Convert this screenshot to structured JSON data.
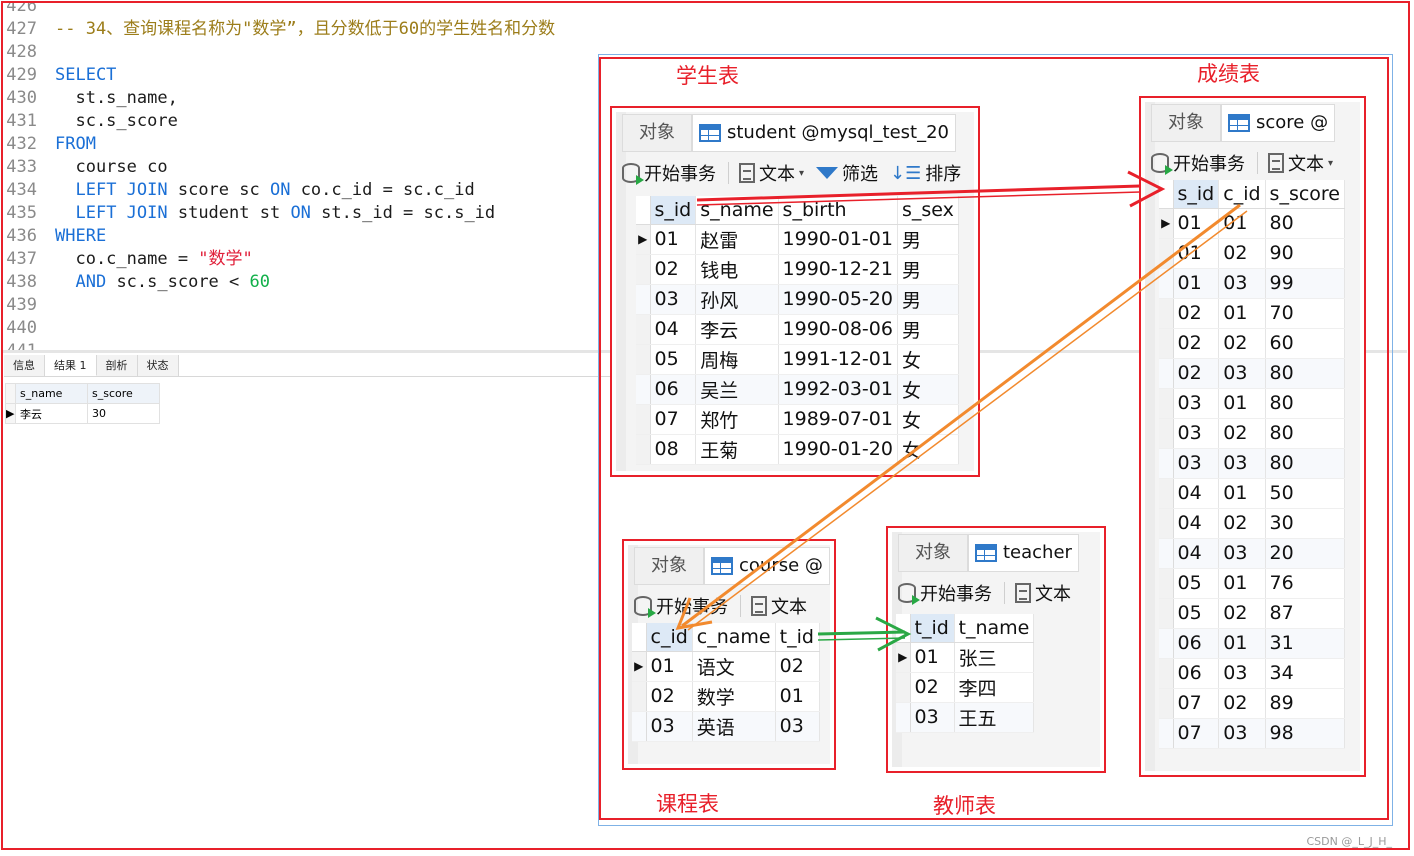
{
  "editor": {
    "lines": [
      {
        "n": "426",
        "parts": []
      },
      {
        "n": "427",
        "parts": [
          {
            "c": "cm",
            "t": "-- 34、查询课程名称为\"数学”，且分数低于60的学生姓名和分数"
          }
        ]
      },
      {
        "n": "428",
        "parts": []
      },
      {
        "n": "429",
        "parts": [
          {
            "c": "kw",
            "t": "SELECT"
          }
        ]
      },
      {
        "n": "430",
        "parts": [
          {
            "c": "tx",
            "t": "  st.s_name,"
          }
        ]
      },
      {
        "n": "431",
        "parts": [
          {
            "c": "tx",
            "t": "  sc.s_score"
          }
        ]
      },
      {
        "n": "432",
        "parts": [
          {
            "c": "kw",
            "t": "FROM"
          }
        ]
      },
      {
        "n": "433",
        "parts": [
          {
            "c": "tx",
            "t": "  course co"
          }
        ]
      },
      {
        "n": "434",
        "parts": [
          {
            "c": "tx",
            "t": "  "
          },
          {
            "c": "kw",
            "t": "LEFT JOIN"
          },
          {
            "c": "tx",
            "t": " score sc "
          },
          {
            "c": "kw",
            "t": "ON"
          },
          {
            "c": "tx",
            "t": " co.c_id = sc.c_id"
          }
        ]
      },
      {
        "n": "435",
        "parts": [
          {
            "c": "tx",
            "t": "  "
          },
          {
            "c": "kw",
            "t": "LEFT JOIN"
          },
          {
            "c": "tx",
            "t": " student st "
          },
          {
            "c": "kw",
            "t": "ON"
          },
          {
            "c": "tx",
            "t": " st.s_id = sc.s_id"
          }
        ]
      },
      {
        "n": "436",
        "parts": [
          {
            "c": "kw",
            "t": "WHERE"
          }
        ]
      },
      {
        "n": "437",
        "parts": [
          {
            "c": "tx",
            "t": "  co.c_name = "
          },
          {
            "c": "str",
            "t": "\"数学\""
          }
        ]
      },
      {
        "n": "438",
        "parts": [
          {
            "c": "tx",
            "t": "  "
          },
          {
            "c": "kw",
            "t": "AND"
          },
          {
            "c": "tx",
            "t": " sc.s_score < "
          },
          {
            "c": "num",
            "t": "60"
          }
        ]
      },
      {
        "n": "439",
        "parts": []
      },
      {
        "n": "440",
        "parts": []
      },
      {
        "n": "441",
        "parts": []
      }
    ]
  },
  "result_panel": {
    "tabs": [
      "信息",
      "结果 1",
      "剖析",
      "状态"
    ],
    "active_tab": 1,
    "columns": [
      "s_name",
      "s_score"
    ],
    "rows": [
      [
        "李云",
        "30"
      ]
    ]
  },
  "labels": {
    "student": "学生表",
    "score": "成绩表",
    "course": "课程表",
    "teacher": "教师表"
  },
  "common": {
    "objects_tab": "对象",
    "begin_tx": "开始事务",
    "text": "文本",
    "filter": "筛选",
    "sort": "排序"
  },
  "student": {
    "tab": "student @mysql_test_20",
    "columns": [
      "s_id",
      "s_name",
      "s_birth",
      "s_sex"
    ],
    "rows": [
      [
        "01",
        "赵雷",
        "1990-01-01",
        "男"
      ],
      [
        "02",
        "钱电",
        "1990-12-21",
        "男"
      ],
      [
        "03",
        "孙风",
        "1990-05-20",
        "男"
      ],
      [
        "04",
        "李云",
        "1990-08-06",
        "男"
      ],
      [
        "05",
        "周梅",
        "1991-12-01",
        "女"
      ],
      [
        "06",
        "吴兰",
        "1992-03-01",
        "女"
      ],
      [
        "07",
        "郑竹",
        "1989-07-01",
        "女"
      ],
      [
        "08",
        "王菊",
        "1990-01-20",
        "女"
      ]
    ]
  },
  "score": {
    "tab": "score @",
    "columns": [
      "s_id",
      "c_id",
      "s_score"
    ],
    "rows": [
      [
        "01",
        "01",
        "80"
      ],
      [
        "01",
        "02",
        "90"
      ],
      [
        "01",
        "03",
        "99"
      ],
      [
        "02",
        "01",
        "70"
      ],
      [
        "02",
        "02",
        "60"
      ],
      [
        "02",
        "03",
        "80"
      ],
      [
        "03",
        "01",
        "80"
      ],
      [
        "03",
        "02",
        "80"
      ],
      [
        "03",
        "03",
        "80"
      ],
      [
        "04",
        "01",
        "50"
      ],
      [
        "04",
        "02",
        "30"
      ],
      [
        "04",
        "03",
        "20"
      ],
      [
        "05",
        "01",
        "76"
      ],
      [
        "05",
        "02",
        "87"
      ],
      [
        "06",
        "01",
        "31"
      ],
      [
        "06",
        "03",
        "34"
      ],
      [
        "07",
        "02",
        "89"
      ],
      [
        "07",
        "03",
        "98"
      ]
    ]
  },
  "course": {
    "tab": "course @",
    "columns": [
      "c_id",
      "c_name",
      "t_id"
    ],
    "rows": [
      [
        "01",
        "语文",
        "02"
      ],
      [
        "02",
        "数学",
        "01"
      ],
      [
        "03",
        "英语",
        "03"
      ]
    ]
  },
  "teacher": {
    "tab": "teacher",
    "columns": [
      "t_id",
      "t_name"
    ],
    "rows": [
      [
        "01",
        "张三"
      ],
      [
        "02",
        "李四"
      ],
      [
        "03",
        "王五"
      ]
    ]
  },
  "watermark": "CSDN @_L_J_H_",
  "colors": {
    "frame_red": "#e8202a",
    "arrow_red": "#e8202a",
    "arrow_orange": "#f28a2e",
    "arrow_green": "#2aa845",
    "keyword_blue": "#1a6fd6"
  }
}
